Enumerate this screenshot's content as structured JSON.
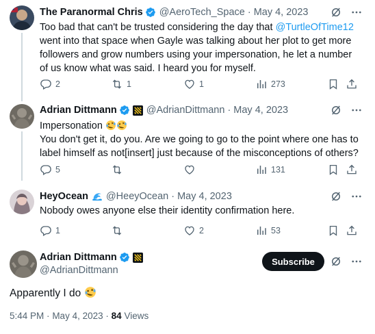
{
  "replies": [
    {
      "name": "The Paranormal Chris",
      "handle": "@AeroTech_Space",
      "date": "May 4, 2023",
      "text_before_link": "Too bad that can't be trusted considering the day that ",
      "link_text": "@TurtleOfTime12",
      "text_after_link": " went into that space when Gayle was talking about her plot to get more followers and grow numbers using your impersonation, he let a number of us know what was said. I heard you for myself.",
      "replies": "2",
      "reposts": "1",
      "likes": "1",
      "views": "273"
    },
    {
      "name": "Adrian Dittmann",
      "handle": "@AdrianDittmann",
      "date": "May 4, 2023",
      "line1": "Impersonation ",
      "text": "You don't get it, do you. Are we going to go to the point where one has to label himself as not[insert] just because of the misconceptions of others?",
      "replies": "5",
      "reposts": "",
      "likes": "",
      "views": "131"
    },
    {
      "name": "HeyOcean",
      "handle": "@HeeyOcean",
      "date": "May 4, 2023",
      "text": "Nobody owes anyone else their identity confirmation here.",
      "replies": "1",
      "reposts": "",
      "likes": "2",
      "views": "53"
    }
  ],
  "main_tweet": {
    "name": "Adrian Dittmann",
    "handle": "@AdrianDittmann",
    "subscribe_label": "Subscribe",
    "text": "Apparently I do ",
    "time": "5:44 PM",
    "date": "May 4, 2023",
    "views_count": "84",
    "views_label": "Views"
  },
  "separator": "·",
  "colors": {
    "accent": "#1d9bf0",
    "text": "#0f1419",
    "muted": "#536471",
    "wave": "#1d9bf0"
  },
  "icons": [
    "verified-badge-icon",
    "grok-icon",
    "more-icon",
    "reply-icon",
    "repost-icon",
    "like-icon",
    "views-icon",
    "bookmark-icon",
    "share-icon",
    "rofl-emoji-icon",
    "wave-emoji-icon",
    "affiliate-badge-icon"
  ]
}
